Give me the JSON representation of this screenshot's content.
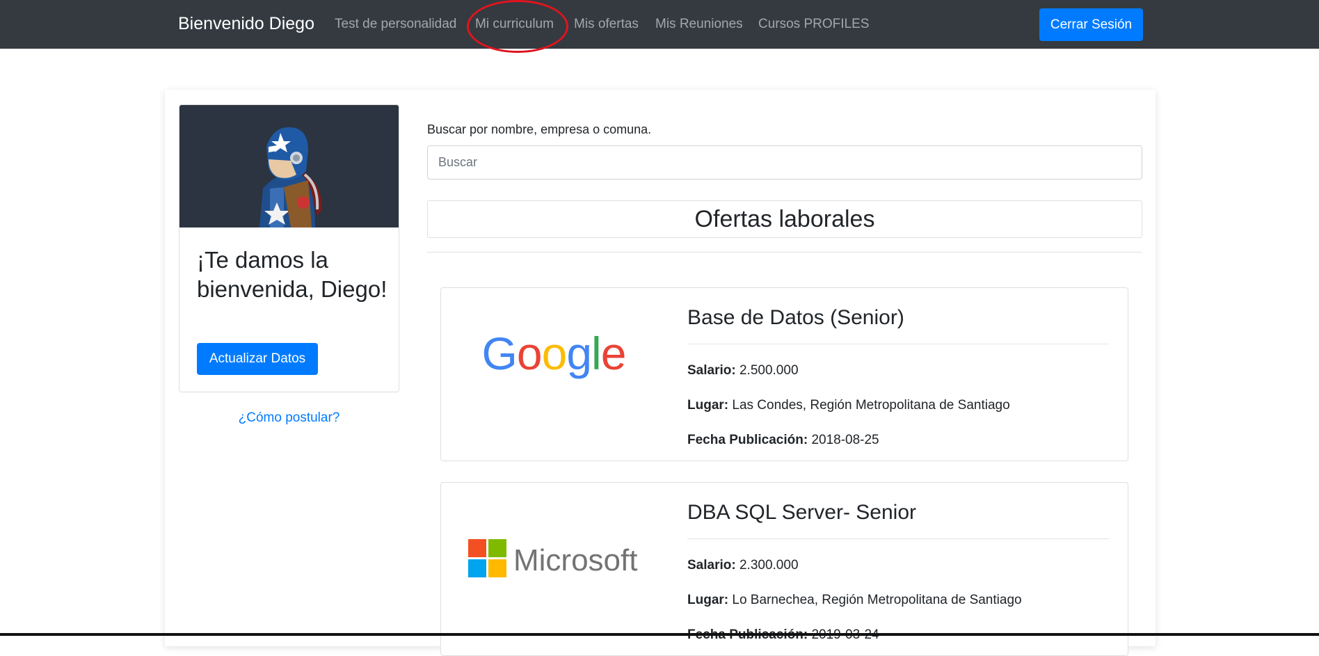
{
  "navbar": {
    "brand": "Bienvenido Diego",
    "links": [
      "Test de personalidad",
      "Mi curriculum",
      "Mis ofertas",
      "Mis Reuniones",
      "Cursos PROFILES"
    ],
    "logout_label": "Cerrar Sesión"
  },
  "profile": {
    "welcome": "¡Te damos la bienvenida, Diego!",
    "update_label": "Actualizar Datos",
    "how_apply": "¿Cómo postular?"
  },
  "search": {
    "label": "Buscar por nombre, empresa o comuna.",
    "placeholder": "Buscar"
  },
  "offers": {
    "heading": "Ofertas laborales",
    "jobs": [
      {
        "company_logo": "Google",
        "title": "Base de Datos (Senior)",
        "salary_label": "Salario:",
        "salary": "2.500.000",
        "place_label": "Lugar:",
        "place": "Las Condes, Región Metropolitana de Santiago",
        "date_label": "Fecha Publicación:",
        "date": "2018-08-25"
      },
      {
        "company_logo": "Microsoft",
        "title": "DBA SQL Server- Senior",
        "salary_label": "Salario:",
        "salary": "2.300.000",
        "place_label": "Lugar:",
        "place": "Lo Barnechea, Región Metropolitana de Santiago",
        "date_label": "Fecha Publicación:",
        "date": "2019-03-24"
      }
    ]
  },
  "colors": {
    "navbar_bg": "#343a40",
    "primary": "#007bff",
    "annotation": "#e0141e"
  }
}
